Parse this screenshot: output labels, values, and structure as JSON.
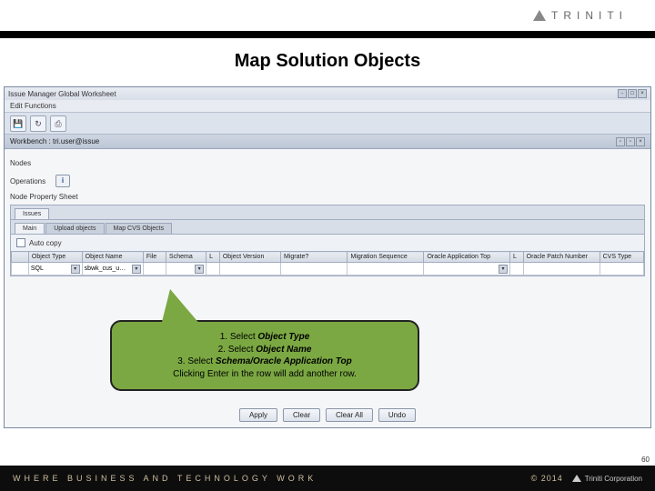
{
  "brand": {
    "name": "TRINITI",
    "footer_name": "Triniti Corporation"
  },
  "slide": {
    "title": "Map Solution Objects",
    "page_number": "60"
  },
  "footer": {
    "tagline": "WHERE BUSINESS AND TECHNOLOGY WORK",
    "copyright": "© 2014"
  },
  "app": {
    "window_title": "Issue Manager Global Worksheet",
    "menu": "Edit  Functions",
    "workbench_label": "Workbench : tri.user@issue",
    "nodes_label": "Nodes",
    "operations_label": "Operations",
    "info_btn": "i",
    "panel_title": "Node Property Sheet",
    "tabs": [
      {
        "label": "Issues",
        "active": true
      },
      {
        "label": "Main",
        "active": false
      },
      {
        "label": "Upload objects",
        "active": false
      },
      {
        "label": "Map CVS Objects",
        "active": false
      }
    ],
    "checkbox_label": "Auto copy",
    "grid": {
      "headers": [
        "",
        "Object Type",
        "Object Name",
        "File",
        "Schema",
        "L",
        "Object Version",
        "Migrate?",
        "Migration Sequence",
        "Oracle Application Top",
        "L",
        "Oracle Patch Number",
        "CVS Type"
      ],
      "row": {
        "object_type": "SQL",
        "object_name": "sbwk_cus_u…"
      }
    },
    "buttons": {
      "apply": "Apply",
      "clear": "Clear",
      "clear_all": "Clear All",
      "undo": "Undo"
    }
  },
  "callout": {
    "lines": [
      {
        "prefix": "1. Select ",
        "bold": "Object Type"
      },
      {
        "prefix": "2. Select ",
        "bold": "Object Name"
      },
      {
        "prefix": "3. Select ",
        "bold": "Schema/Oracle Application Top"
      },
      {
        "prefix": "Clicking Enter in the row will add another row.",
        "bold": ""
      }
    ]
  }
}
